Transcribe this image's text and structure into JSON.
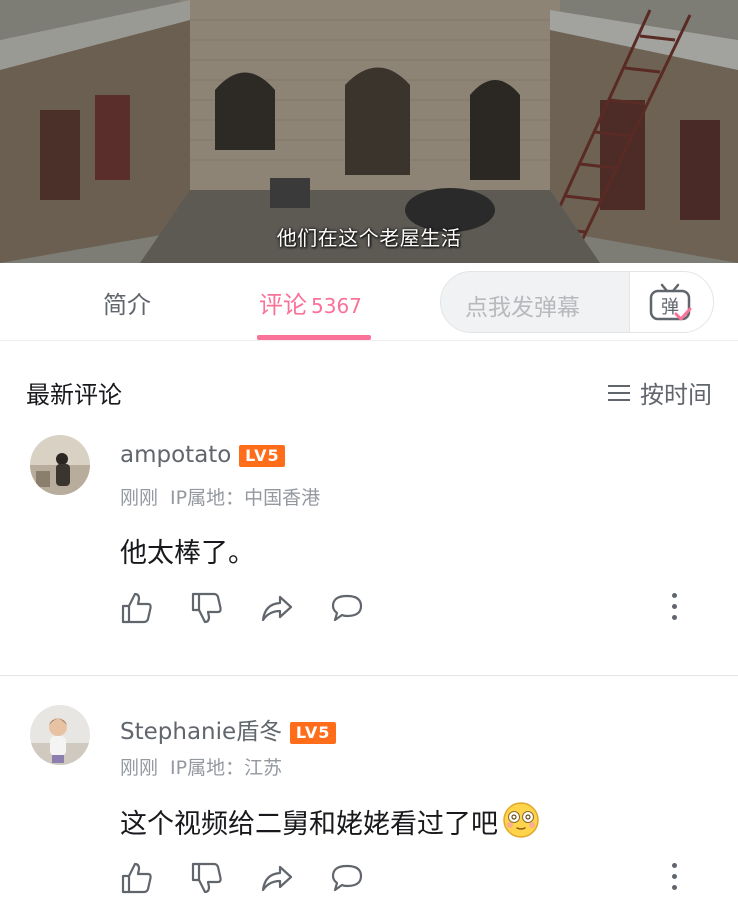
{
  "video": {
    "subtitle": "他们在这个老屋生活"
  },
  "tabs": {
    "intro_label": "简介",
    "comments_label": "评论",
    "comments_count": "5367",
    "danmaku_placeholder": "点我发弹幕",
    "danmaku_button_label": "弹"
  },
  "sort": {
    "title": "最新评论",
    "toggle_label": "按时间",
    "toggle_icon": "list-menu-icon"
  },
  "comments": [
    {
      "username": "ampotato",
      "level": "LV5",
      "time": "刚刚",
      "ip": "IP属地：中国香港",
      "content": "他太棒了。"
    },
    {
      "username": "Stephanie盾冬",
      "level": "LV5",
      "time": "刚刚",
      "ip": "IP属地：江苏",
      "content": "这个视频给二舅和姥姥看过了吧",
      "emoji": "dizzy-face-emoji"
    }
  ],
  "action_icons": [
    "thumb-up-icon",
    "thumb-down-icon",
    "share-icon",
    "reply-icon",
    "more-icon"
  ],
  "colors": {
    "accent": "#fb7299",
    "level_badge": "#ff6d1a",
    "secondary_text": "#61666d",
    "muted_text": "#9499a0"
  }
}
